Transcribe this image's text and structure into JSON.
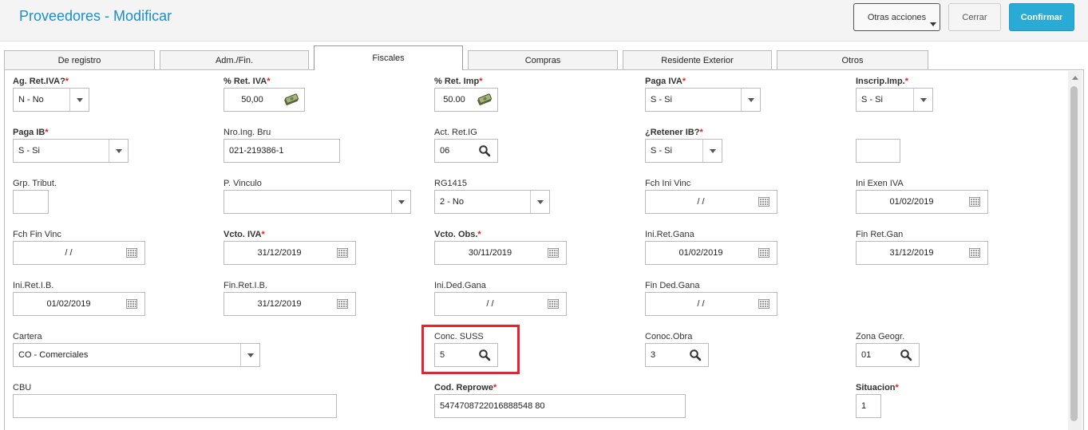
{
  "header": {
    "title": "Proveedores - Modificar",
    "buttons": {
      "otras": "Otras acciones",
      "cerrar": "Cerrar",
      "confirmar": "Confirmar"
    }
  },
  "tabs": [
    {
      "label": "De registro",
      "active": false
    },
    {
      "label": "Adm./Fin.",
      "active": false
    },
    {
      "label": "Fiscales",
      "active": true
    },
    {
      "label": "Compras",
      "active": false
    },
    {
      "label": "Residente Exterior",
      "active": false
    },
    {
      "label": "Otros",
      "active": false
    }
  ],
  "fields": {
    "ag_ret_iva": {
      "label": "Ag. Ret.IVA?",
      "required": true,
      "type": "select",
      "value": "N - No"
    },
    "pct_ret_iva": {
      "label": "% Ret. IVA",
      "required": true,
      "type": "money",
      "value": "50,00"
    },
    "pct_ret_imp": {
      "label": "% Ret. Imp",
      "required": true,
      "type": "money",
      "value": "50.00"
    },
    "paga_iva": {
      "label": "Paga IVA",
      "required": true,
      "type": "select",
      "value": "S - Si"
    },
    "inscrip_imp": {
      "label": "Inscrip.Imp.",
      "required": true,
      "type": "select",
      "value": "S - Si"
    },
    "paga_ib": {
      "label": "Paga IB",
      "required": true,
      "type": "select",
      "value": "S - Si"
    },
    "nro_ing_bru": {
      "label": "Nro.Ing. Bru",
      "required": false,
      "type": "text",
      "value": "021-219386-1"
    },
    "act_ret_ig": {
      "label": "Act. Ret.IG",
      "required": false,
      "type": "lookup",
      "value": "06"
    },
    "retener_ib": {
      "label": "¿Retener IB?",
      "required": true,
      "type": "select",
      "value": "S - Si"
    },
    "unlabeled_box": {
      "label": "",
      "required": false,
      "type": "text",
      "value": ""
    },
    "grp_tribut": {
      "label": "Grp. Tribut.",
      "required": false,
      "type": "text",
      "value": ""
    },
    "p_vinculo": {
      "label": "P. Vinculo",
      "required": false,
      "type": "select",
      "value": ""
    },
    "rg1415": {
      "label": "RG1415",
      "required": false,
      "type": "select",
      "value": "2 - No"
    },
    "fch_ini_vinc": {
      "label": "Fch Ini Vinc",
      "required": false,
      "type": "date",
      "value": "/ /"
    },
    "ini_exen_iva": {
      "label": "Ini Exen IVA",
      "required": false,
      "type": "date",
      "value": "01/02/2019"
    },
    "fch_fin_vinc": {
      "label": "Fch Fin Vinc",
      "required": false,
      "type": "date",
      "value": "/ /"
    },
    "vcto_iva": {
      "label": "Vcto. IVA",
      "required": true,
      "type": "date",
      "value": "31/12/2019"
    },
    "vcto_obs": {
      "label": "Vcto. Obs.",
      "required": true,
      "type": "date",
      "value": "30/11/2019"
    },
    "ini_ret_gana": {
      "label": "Ini.Ret.Gana",
      "required": false,
      "type": "date",
      "value": "01/02/2019"
    },
    "fin_ret_gan": {
      "label": "Fin Ret.Gan",
      "required": false,
      "type": "date",
      "value": "31/12/2019"
    },
    "ini_ret_ib": {
      "label": "Ini.Ret.I.B.",
      "required": false,
      "type": "date",
      "value": "01/02/2019"
    },
    "fin_ret_ib": {
      "label": "Fin.Ret.I.B.",
      "required": false,
      "type": "date",
      "value": "31/12/2019"
    },
    "ini_ded_gana": {
      "label": "Ini.Ded.Gana",
      "required": false,
      "type": "date",
      "value": "/ /"
    },
    "fin_ded_gana": {
      "label": "Fin Ded.Gana",
      "required": false,
      "type": "date",
      "value": "/ /"
    },
    "cartera": {
      "label": "Cartera",
      "required": false,
      "type": "select",
      "value": "CO - Comerciales"
    },
    "conc_suss": {
      "label": "Conc. SUSS",
      "required": false,
      "type": "lookup",
      "value": "5"
    },
    "conoc_obra": {
      "label": "Conoc.Obra",
      "required": false,
      "type": "lookup",
      "value": "3"
    },
    "zona_geogr": {
      "label": "Zona Geogr.",
      "required": false,
      "type": "lookup",
      "value": "01"
    },
    "cbu": {
      "label": "CBU",
      "required": false,
      "type": "text",
      "value": ""
    },
    "cod_reprowe": {
      "label": "Cod. Reprowe",
      "required": true,
      "type": "text",
      "value": "5474708722016888548 80"
    },
    "situacion": {
      "label": "Situacion",
      "required": true,
      "type": "text",
      "value": "1"
    }
  },
  "highlight": {
    "field": "conc_suss",
    "color": "#e2262f"
  },
  "colors": {
    "title": "#1b8fc7",
    "confirm": "#29abd6",
    "required_star": "#dd2222"
  },
  "icons": {
    "select": "chevron-down-icon",
    "money": "money-icon",
    "lookup": "search-icon",
    "date": "calendar-icon"
  }
}
